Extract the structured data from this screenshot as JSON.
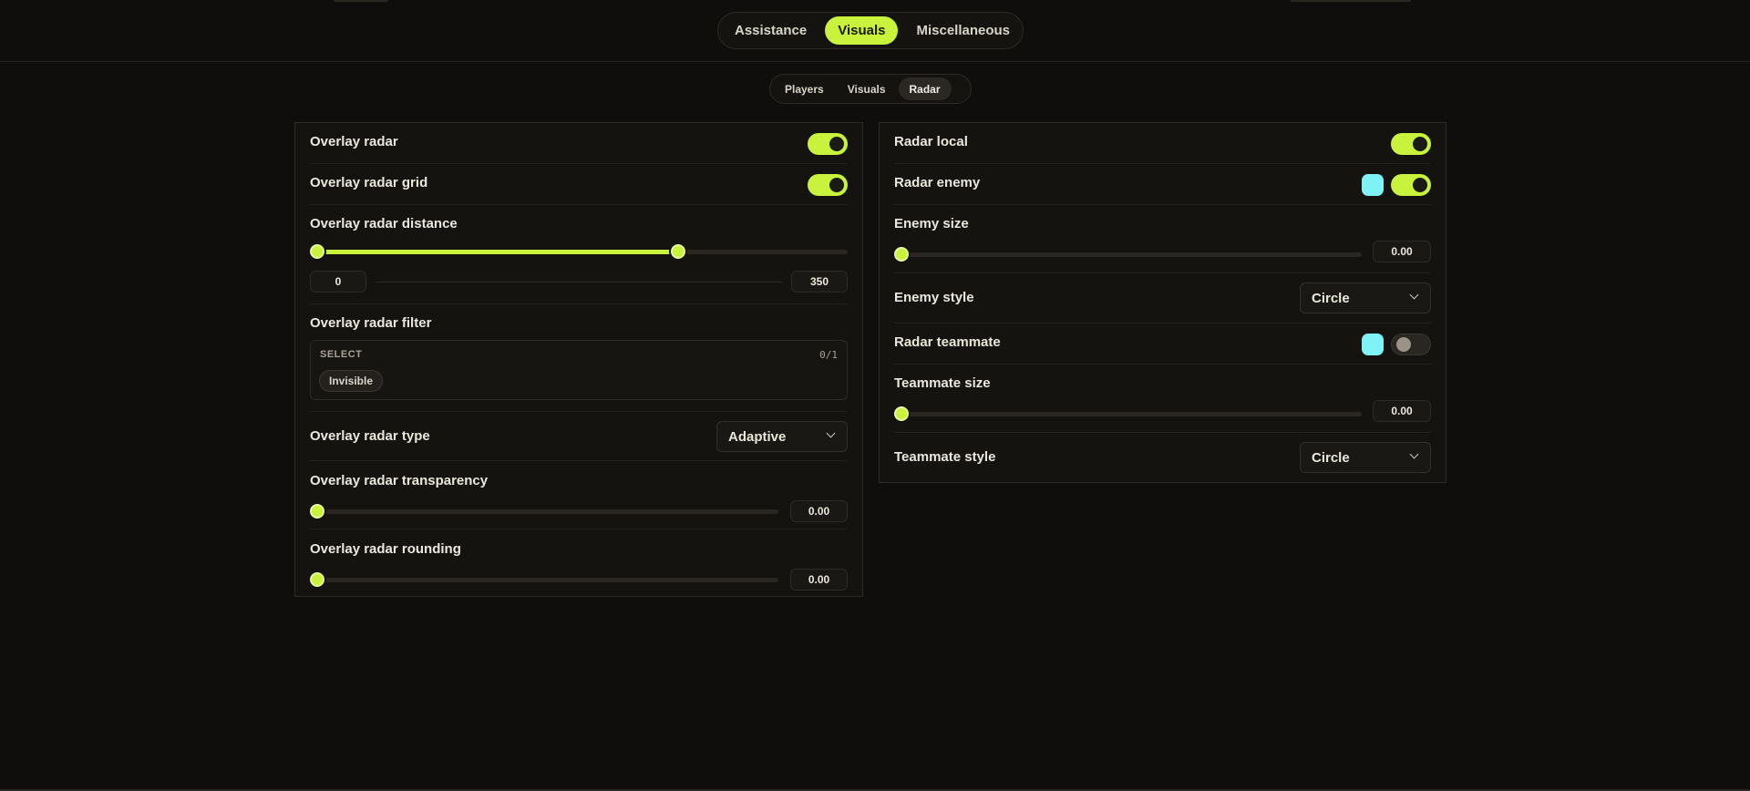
{
  "main_tabs": [
    {
      "label": "Assistance",
      "active": false
    },
    {
      "label": "Visuals",
      "active": true
    },
    {
      "label": "Miscellaneous",
      "active": false
    }
  ],
  "sub_tabs": [
    {
      "label": "Players",
      "active": false
    },
    {
      "label": "Visuals",
      "active": false
    },
    {
      "label": "Radar",
      "active": true
    }
  ],
  "left": {
    "overlay_radar": {
      "label": "Overlay radar",
      "enabled": true
    },
    "overlay_radar_grid": {
      "label": "Overlay radar grid",
      "enabled": true
    },
    "distance": {
      "label": "Overlay radar distance",
      "min": "0",
      "max": "350",
      "fraction": 0.68
    },
    "filter": {
      "label": "Overlay radar filter",
      "header": "SELECT",
      "count": "0/1",
      "chip": "Invisible"
    },
    "type": {
      "label": "Overlay radar type",
      "value": "Adaptive"
    },
    "transparency": {
      "label": "Overlay radar transparency",
      "value": "0.00",
      "fraction": 0
    },
    "rounding": {
      "label": "Overlay radar rounding",
      "value": "0.00",
      "fraction": 0
    }
  },
  "right": {
    "radar_local": {
      "label": "Radar local",
      "enabled": true
    },
    "radar_enemy": {
      "label": "Radar enemy",
      "enabled": true,
      "color": "#7ff2f5"
    },
    "enemy_size": {
      "label": "Enemy size",
      "value": "0.00",
      "fraction": 0
    },
    "enemy_style": {
      "label": "Enemy style",
      "value": "Circle"
    },
    "radar_teammate": {
      "label": "Radar teammate",
      "enabled": false,
      "color": "#7ff2f5"
    },
    "teammate_size": {
      "label": "Teammate size",
      "value": "0.00",
      "fraction": 0
    },
    "teammate_style": {
      "label": "Teammate style",
      "value": "Circle"
    }
  },
  "colors": {
    "accent": "#c8f23c",
    "background": "#0f0e0c",
    "panel": "#141310"
  }
}
